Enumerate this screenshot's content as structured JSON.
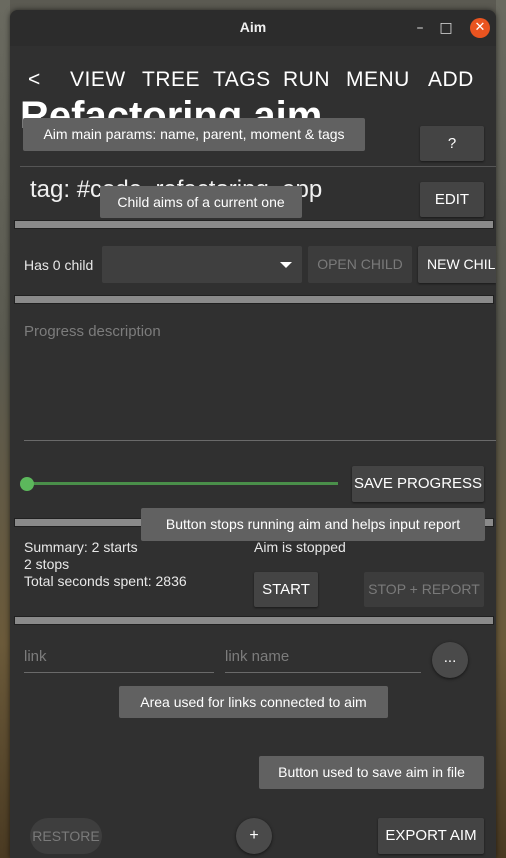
{
  "window": {
    "title": "Aim"
  },
  "menu": {
    "back": "<",
    "items": [
      "VIEW",
      "TREE",
      "TAGS",
      "RUN",
      "MENU",
      "ADD"
    ]
  },
  "aim": {
    "title": "Refactoring aim",
    "tag_line": "tag: #code_refactoring_app"
  },
  "tooltips": {
    "main_params": "Aim main params: name, parent, moment & tags",
    "child_aims": "Child aims of a current one",
    "stop_button": "Button stops running aim and helps input report",
    "links_area": "Area used for links connected to aim",
    "save_button": "Button used to save aim in file"
  },
  "buttons": {
    "help": "?",
    "edit": "EDIT",
    "open_child": "OPEN CHILD",
    "new_child": "NEW CHILD",
    "save_progress": "SAVE PROGRESS",
    "start": "START",
    "stop_report": "STOP + REPORT",
    "more": "...",
    "restore": "RESTORE",
    "add": "+",
    "export": "EXPORT AIM"
  },
  "children": {
    "count_label": "Has 0 child",
    "selected": ""
  },
  "progress": {
    "placeholder": "Progress description",
    "slider_value": 0
  },
  "summary": {
    "line1": "Summary: 2 starts",
    "line2": "2 stops",
    "line3": "Total seconds spent: 2836",
    "status": "Aim is stopped"
  },
  "links": {
    "link_placeholder": "link",
    "name_placeholder": "link name"
  },
  "colors": {
    "close_button": "#e95420",
    "slider": "#5cb85c"
  }
}
